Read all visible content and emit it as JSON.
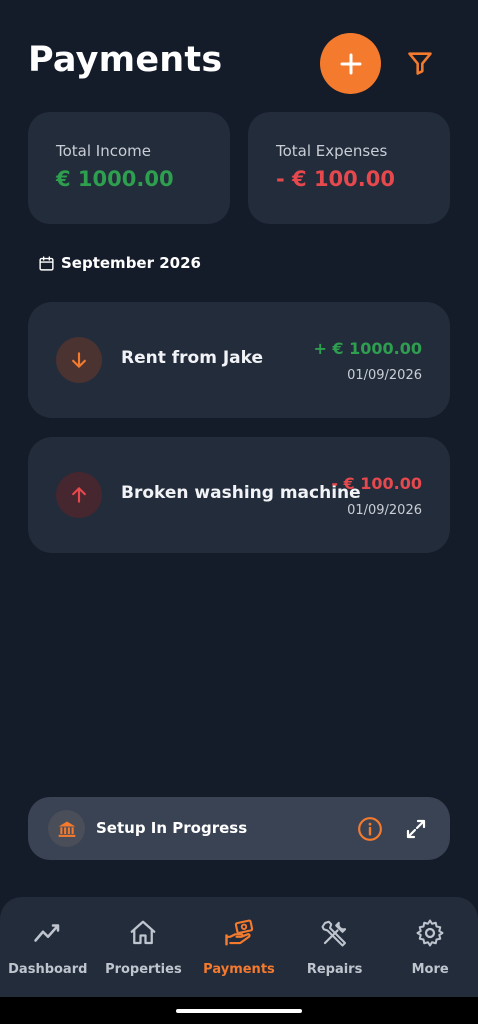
{
  "header": {
    "title": "Payments",
    "add_icon": "plus-icon",
    "filter_icon": "filter-icon"
  },
  "summary": {
    "income_label": "Total Income",
    "income_value": "€ 1000.00",
    "expenses_label": "Total Expenses",
    "expenses_value": "- € 100.00"
  },
  "month": {
    "label": "September 2026",
    "icon": "calendar-icon"
  },
  "transactions": [
    {
      "name": "Rent from Jake",
      "amount": "+ € 1000.00",
      "date": "01/09/2026",
      "type": "income",
      "icon": "arrow-down-icon"
    },
    {
      "name": "Broken washing machine",
      "amount": "- € 100.00",
      "date": "01/09/2026",
      "type": "expense",
      "icon": "arrow-up-icon"
    }
  ],
  "setup": {
    "label": "Setup In Progress",
    "icon": "bank-icon",
    "info_icon": "info-icon",
    "expand_icon": "expand-icon"
  },
  "nav": {
    "items": [
      {
        "label": "Dashboard",
        "icon": "chart-line-icon",
        "active": false
      },
      {
        "label": "Properties",
        "icon": "house-icon",
        "active": false
      },
      {
        "label": "Payments",
        "icon": "hand-money-icon",
        "active": true
      },
      {
        "label": "Repairs",
        "icon": "tools-icon",
        "active": false
      },
      {
        "label": "More",
        "icon": "gear-icon",
        "active": false
      }
    ]
  },
  "colors": {
    "background": "#141b29",
    "card": "#232c3b",
    "accent": "#f47a2e",
    "income": "#2e9e4f",
    "expense": "#e5484d"
  }
}
